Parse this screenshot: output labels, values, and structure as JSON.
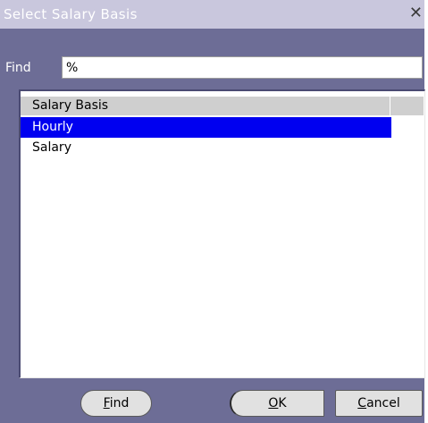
{
  "window": {
    "title": "Select Salary Basis",
    "close_icon": "close-icon"
  },
  "find": {
    "label": "Find",
    "value": "%"
  },
  "list": {
    "column_header": "Salary Basis",
    "rows": [
      {
        "label": "Hourly",
        "selected": true
      },
      {
        "label": "Salary",
        "selected": false
      }
    ]
  },
  "buttons": {
    "find": {
      "first": "F",
      "rest": "ind"
    },
    "ok": {
      "first": "O",
      "rest": "K"
    },
    "cancel": {
      "first": "C",
      "rest": "ancel"
    }
  },
  "colors": {
    "dialog_bg": "#6d6d96",
    "titlebar_bg": "#c9c7dd",
    "selection": "#0000f0"
  }
}
